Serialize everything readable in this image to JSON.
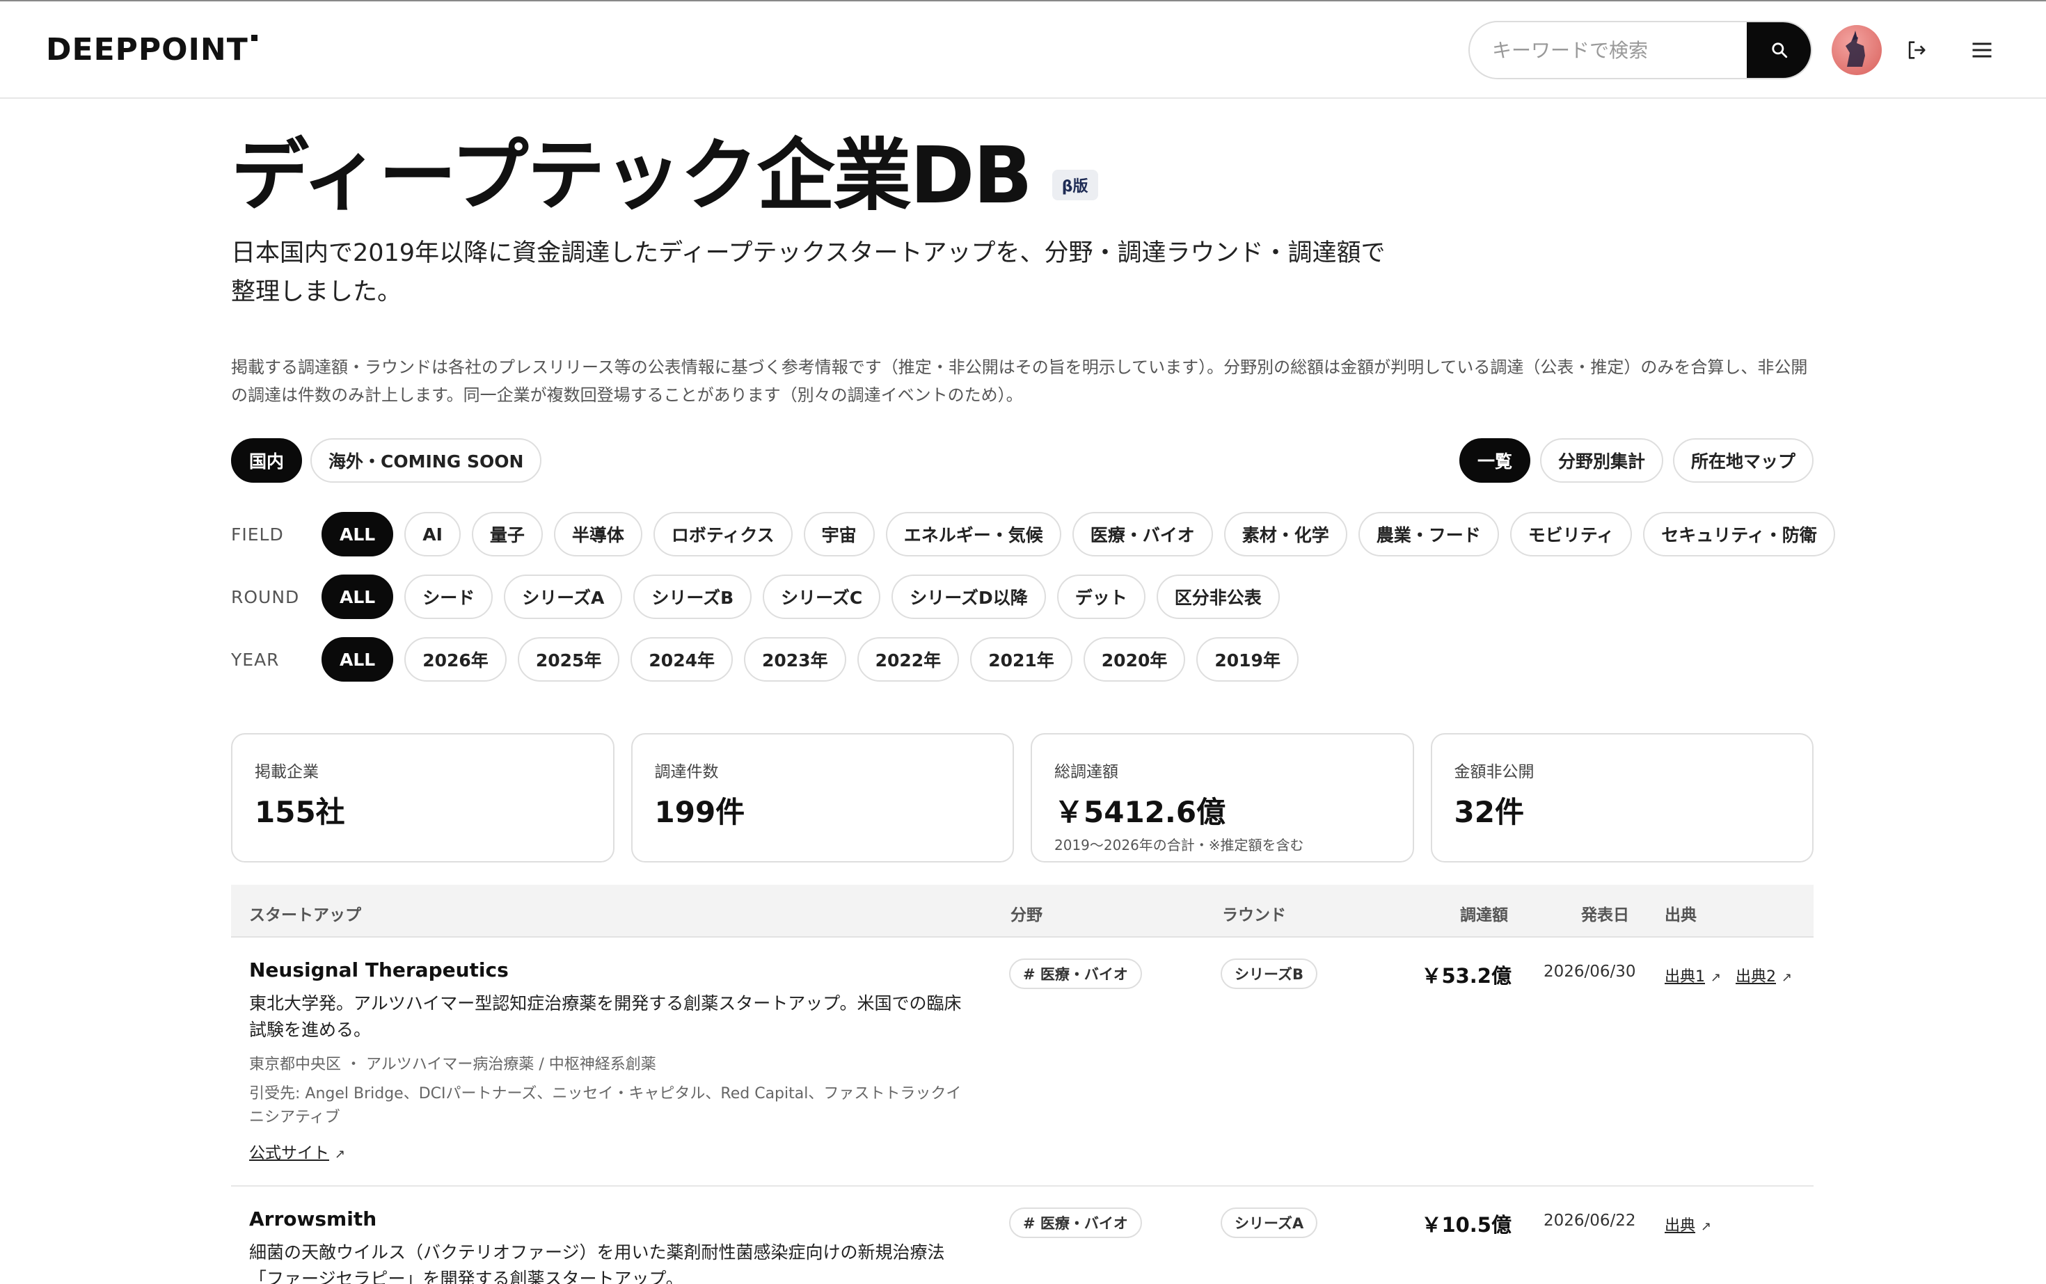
{
  "header": {
    "logo": "DEEPPOINT",
    "search_placeholder": "キーワードで検索",
    "icons": {
      "search": "search-icon",
      "logout": "logout-icon",
      "menu": "hamburger-menu-icon",
      "avatar": "user-avatar"
    }
  },
  "page": {
    "title": "ディープテック企業DB",
    "beta": "β版",
    "subtitle": "日本国内で2019年以降に資金調達したディープテックスタートアップを、分野・調達ラウンド・調達額で整理しました。",
    "note": "掲載する調達額・ラウンドは各社のプレスリリース等の公表情報に基づく参考情報です（推定・非公開はその旨を明示しています）。分野別の総額は金額が判明している調達（公表・推定）のみを合算し、非公開の調達は件数のみ計上します。同一企業が複数回登場することがあります（別々の調達イベントのため）。"
  },
  "region_tabs": [
    {
      "label": "国内",
      "active": true
    },
    {
      "label": "海外・COMING SOON",
      "active": false
    }
  ],
  "view_tabs": [
    {
      "label": "一覧",
      "active": true
    },
    {
      "label": "分野別集計",
      "active": false
    },
    {
      "label": "所在地マップ",
      "active": false
    }
  ],
  "filters": {
    "field": {
      "label": "FIELD",
      "options": [
        "ALL",
        "AI",
        "量子",
        "半導体",
        "ロボティクス",
        "宇宙",
        "エネルギー・気候",
        "医療・バイオ",
        "素材・化学",
        "農業・フード",
        "モビリティ",
        "セキュリティ・防衛"
      ]
    },
    "round": {
      "label": "ROUND",
      "options": [
        "ALL",
        "シード",
        "シリーズA",
        "シリーズB",
        "シリーズC",
        "シリーズD以降",
        "デット",
        "区分非公表"
      ]
    },
    "year": {
      "label": "YEAR",
      "options": [
        "ALL",
        "2026年",
        "2025年",
        "2024年",
        "2023年",
        "2022年",
        "2021年",
        "2020年",
        "2019年"
      ]
    }
  },
  "stats": [
    {
      "label": "掲載企業",
      "value": "155社",
      "sub": ""
    },
    {
      "label": "調達件数",
      "value": "199件",
      "sub": ""
    },
    {
      "label": "総調達額",
      "value": "￥5412.6億",
      "sub": "2019〜2026年の合計・※推定額を含む"
    },
    {
      "label": "金額非公開",
      "value": "32件",
      "sub": ""
    }
  ],
  "table": {
    "headers": {
      "startup": "スタートアップ",
      "field": "分野",
      "round": "ラウンド",
      "amount": "調達額",
      "date": "発表日",
      "source": "出典"
    },
    "rows": [
      {
        "name": "Neusignal Therapeutics",
        "desc": "東北大学発。アルツハイマー型認知症治療薬を開発する創薬スタートアップ。米国での臨床試験を進める。",
        "location": "東京都中央区 ・ アルツハイマー病治療薬 / 中枢神経系創薬",
        "investors": "引受先: Angel Bridge、DCIパートナーズ、ニッセイ・キャピタル、Red Capital、ファストトラックイニシアティブ",
        "site": "公式サイト",
        "field": "# 医療・バイオ",
        "round": "シリーズB",
        "amount": "￥53.2億",
        "date": "2026/06/30",
        "sources": [
          "出典1",
          "出典2"
        ]
      },
      {
        "name": "Arrowsmith",
        "desc": "細菌の天敵ウイルス（バクテリオファージ）を用いた薬剤耐性菌感染症向けの新規治療法「ファージセラピー」を開発する創薬スタートアップ。",
        "field": "# 医療・バイオ",
        "round": "シリーズA",
        "amount": "￥10.5億",
        "date": "2026/06/22",
        "sources": [
          "出典"
        ]
      }
    ]
  }
}
